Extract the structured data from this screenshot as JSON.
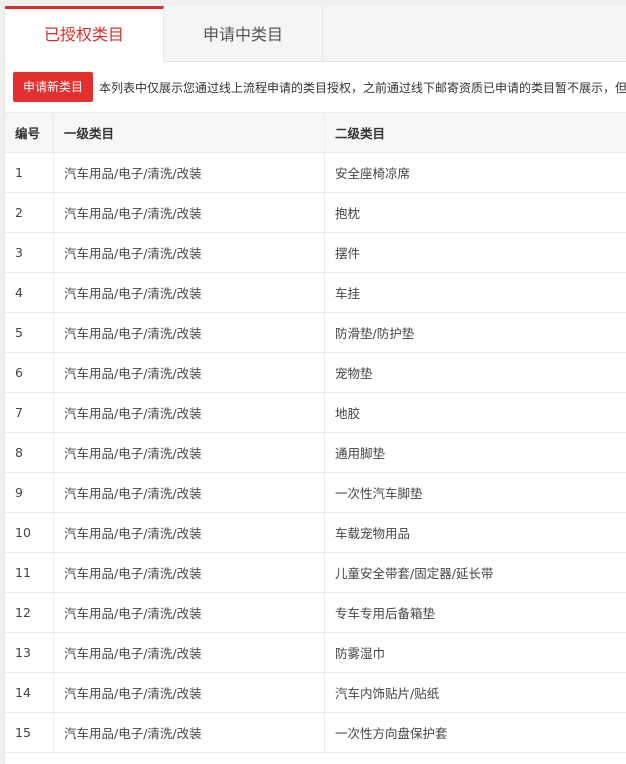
{
  "tabs": [
    {
      "label": "已授权类目",
      "active": true
    },
    {
      "label": "申请中类目",
      "active": false
    }
  ],
  "toolbar": {
    "apply_label": "申请新类目",
    "notice": "本列表中仅展示您通过线上流程申请的类目授权，之前通过线下邮寄资质已申请的类目暂不展示，但"
  },
  "table": {
    "columns": [
      "编号",
      "一级类目",
      "二级类目"
    ],
    "rows": [
      [
        "1",
        "汽车用品/电子/清洗/改装",
        "安全座椅凉席"
      ],
      [
        "2",
        "汽车用品/电子/清洗/改装",
        "抱枕"
      ],
      [
        "3",
        "汽车用品/电子/清洗/改装",
        "摆件"
      ],
      [
        "4",
        "汽车用品/电子/清洗/改装",
        "车挂"
      ],
      [
        "5",
        "汽车用品/电子/清洗/改装",
        "防滑垫/防护垫"
      ],
      [
        "6",
        "汽车用品/电子/清洗/改装",
        "宠物垫"
      ],
      [
        "7",
        "汽车用品/电子/清洗/改装",
        "地胶"
      ],
      [
        "8",
        "汽车用品/电子/清洗/改装",
        "通用脚垫"
      ],
      [
        "9",
        "汽车用品/电子/清洗/改装",
        "一次性汽车脚垫"
      ],
      [
        "10",
        "汽车用品/电子/清洗/改装",
        "车载宠物用品"
      ],
      [
        "11",
        "汽车用品/电子/清洗/改装",
        "儿童安全带套/固定器/延长带"
      ],
      [
        "12",
        "汽车用品/电子/清洗/改装",
        "专车专用后备箱垫"
      ],
      [
        "13",
        "汽车用品/电子/清洗/改装",
        "防雾湿巾"
      ],
      [
        "14",
        "汽车用品/电子/清洗/改装",
        "汽车内饰贴片/贴纸"
      ],
      [
        "15",
        "汽车用品/电子/清洗/改装",
        "一次性方向盘保护套"
      ]
    ]
  },
  "colors": {
    "accent": "#d9302c",
    "button": "#e3302f"
  }
}
